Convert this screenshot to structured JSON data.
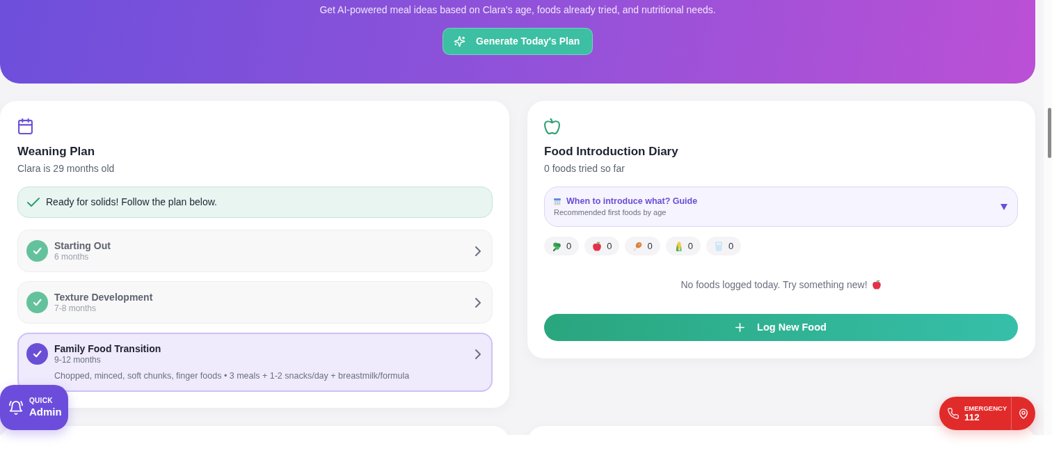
{
  "hero": {
    "subtitle": "Get AI-powered meal ideas based on Clara's age, foods already tried, and nutritional needs.",
    "button": "Generate Today's Plan"
  },
  "weaning_plan": {
    "title": "Weaning Plan",
    "subtitle": "Clara is 29 months old",
    "alert": "Ready for solids! Follow the plan below.",
    "stages": [
      {
        "title": "Starting Out",
        "age": "6 months",
        "completed": true,
        "selected": false
      },
      {
        "title": "Texture Development",
        "age": "7-8 months",
        "completed": true,
        "selected": false
      },
      {
        "title": "Family Food Transition",
        "age": "9-12 months",
        "completed": true,
        "selected": true,
        "details": "Chopped, minced, soft chunks, finger foods • 3 meals + 1-2 snacks/day + breastmilk/formula"
      }
    ]
  },
  "food_diary": {
    "title": "Food Introduction Diary",
    "subtitle": "0 foods tried so far",
    "guide": {
      "title": "When to introduce what? Guide",
      "subtitle": "Recommended first foods by age"
    },
    "categories": [
      {
        "kind": "broccoli",
        "count": "0"
      },
      {
        "kind": "apple",
        "count": "0"
      },
      {
        "kind": "drumstick",
        "count": "0"
      },
      {
        "kind": "corn",
        "count": "0"
      },
      {
        "kind": "milk",
        "count": "0"
      }
    ],
    "empty_message": "No foods logged today. Try something new!",
    "button": "Log New Food"
  },
  "quick_admin": {
    "label": "QUICK",
    "title": "Admin"
  },
  "emergency": {
    "label": "EMERGENCY",
    "number": "112"
  }
}
